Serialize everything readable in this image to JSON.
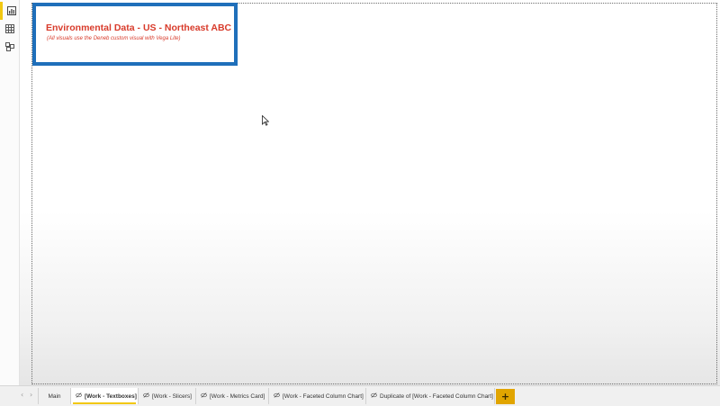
{
  "sidebar": {
    "items": [
      {
        "icon": "report-view-icon",
        "active": true
      },
      {
        "icon": "data-view-icon",
        "active": false
      },
      {
        "icon": "model-view-icon",
        "active": false
      }
    ]
  },
  "textbox": {
    "title": "Environmental Data - US - Northeast ABC",
    "subtitle": "(All visuals use the Deneb custom visual with Vega Lite)"
  },
  "pages": {
    "nav_prev": "‹",
    "nav_next": "›",
    "tabs": [
      {
        "label": "Main",
        "hidden": false,
        "active": false
      },
      {
        "label": "[Work - Textboxes]",
        "hidden": true,
        "active": true
      },
      {
        "label": "[Work - Slicers]",
        "hidden": true,
        "active": false
      },
      {
        "label": "[Work - Metrics Card]",
        "hidden": true,
        "active": false
      },
      {
        "label": "[Work - Faceted Column Chart]",
        "hidden": true,
        "active": false
      },
      {
        "label": "Duplicate of [Work - Faceted Column Chart]",
        "hidden": true,
        "active": false
      }
    ],
    "add_label": "+"
  },
  "colors": {
    "title_text": "#d83b2b",
    "textbox_border": "#1f6fba",
    "accent": "#f2c811",
    "add_button": "#e1a500"
  }
}
